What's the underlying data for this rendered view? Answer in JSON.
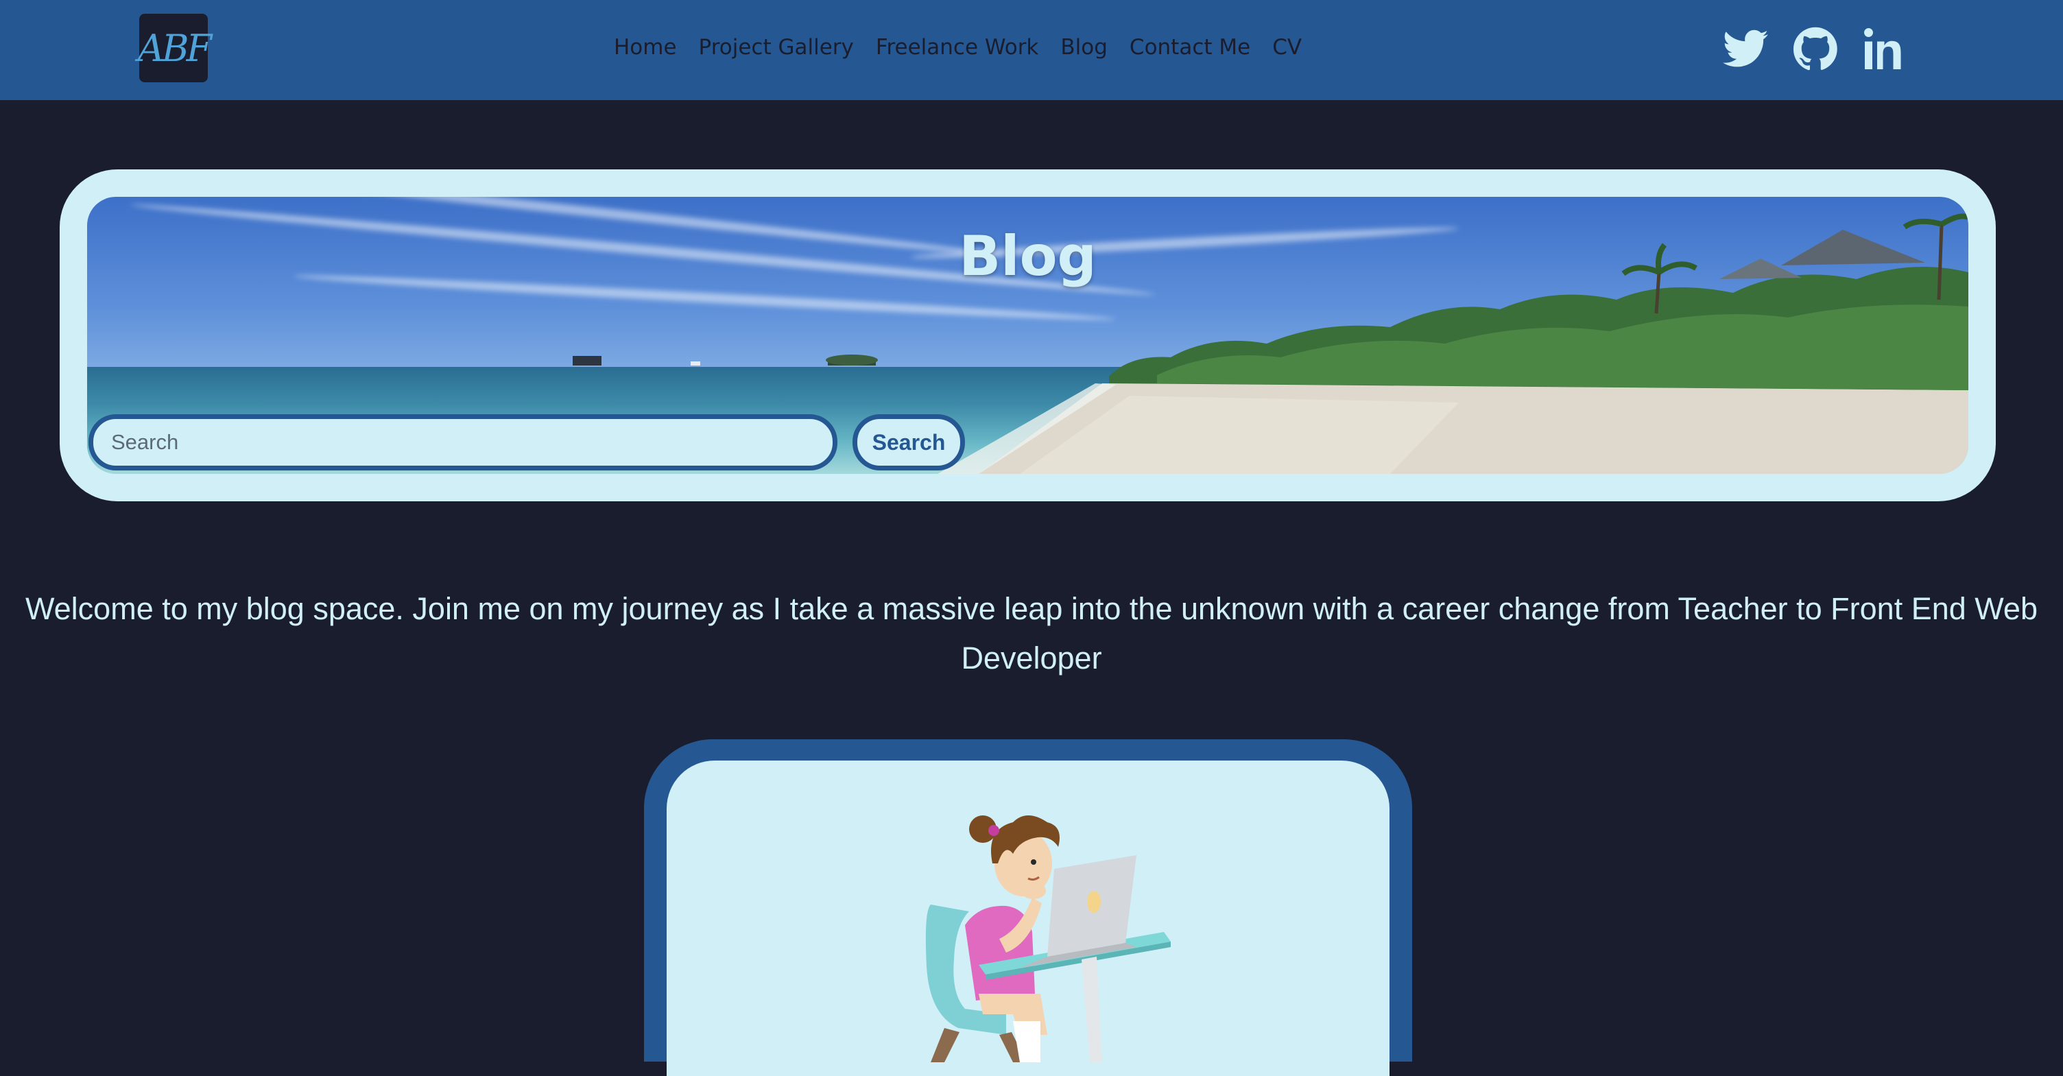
{
  "navbar": {
    "logo_text": "ABF",
    "links": [
      "Home",
      "Project Gallery",
      "Freelance Work",
      "Blog",
      "Contact Me",
      "CV"
    ],
    "social_icons": [
      "twitter-icon",
      "github-icon",
      "linkedin-icon"
    ]
  },
  "hero": {
    "title": "Blog",
    "search_placeholder": "Search",
    "search_button_label": "Search"
  },
  "intro": {
    "text": "Welcome to my blog space. Join me on my journey as I take a massive leap into the unknown with a career change from Teacher to Front End Web Developer"
  },
  "colors": {
    "navbar_bg": "#255892",
    "page_bg": "#1a1d2e",
    "light_accent": "#d0eff7",
    "nav_text": "#1a1d2e",
    "logo_text": "#4fa3d9"
  }
}
